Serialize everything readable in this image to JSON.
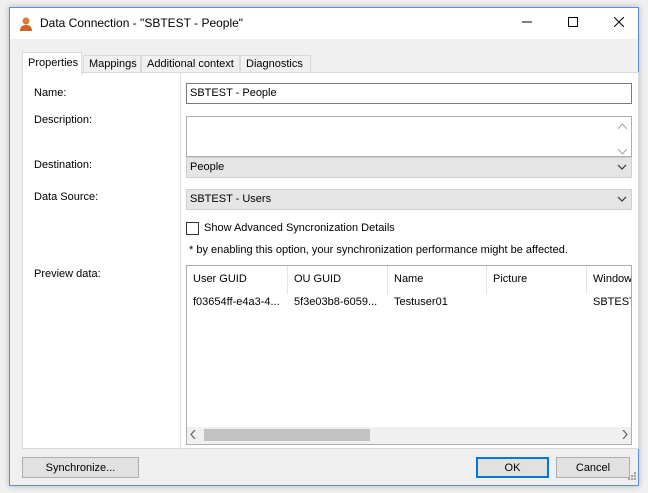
{
  "window": {
    "title": "Data Connection - \"SBTEST - People\"",
    "icons": {
      "app": "person-icon",
      "minimize": "minimize-icon",
      "maximize": "maximize-icon",
      "close": "close-icon"
    }
  },
  "tabs": [
    {
      "label": "Properties",
      "active": true
    },
    {
      "label": "Mappings",
      "active": false
    },
    {
      "label": "Additional context",
      "active": false
    },
    {
      "label": "Diagnostics",
      "active": false
    }
  ],
  "form": {
    "name_label": "Name:",
    "name_value": "SBTEST - People",
    "description_label": "Description:",
    "description_value": "",
    "destination_label": "Destination:",
    "destination_value": "People",
    "datasource_label": "Data Source:",
    "datasource_value": "SBTEST - Users",
    "advanced_checkbox_label": "Show Advanced Syncronization Details",
    "advanced_checked": false,
    "advanced_note": "* by enabling this option, your synchronization performance might be affected.",
    "preview_label": "Preview data:"
  },
  "preview": {
    "columns": [
      "User GUID",
      "OU GUID",
      "Name",
      "Picture",
      "Window"
    ],
    "rows": [
      [
        "f03654ff-e4a3-4...",
        "5f3e03b8-6059...",
        "Testuser01",
        "",
        "SBTEST"
      ]
    ]
  },
  "buttons": {
    "synchronize": "Synchronize...",
    "ok": "OK",
    "cancel": "Cancel"
  },
  "colors": {
    "accent": "#0078d7",
    "window_border": "#5c8fd6",
    "panel_bg": "#ffffff",
    "dialog_bg": "#f0f0f0"
  }
}
